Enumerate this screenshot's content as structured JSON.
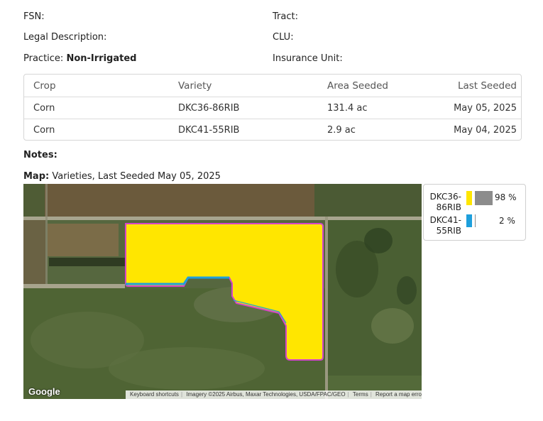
{
  "fields": {
    "fsn_label": "FSN:",
    "tract_label": "Tract:",
    "legal_label": "Legal Description:",
    "clu_label": "CLU:",
    "practice_label": "Practice:",
    "practice_value": "Non-Irrigated",
    "insurance_label": "Insurance Unit:"
  },
  "table": {
    "headers": [
      "Crop",
      "Variety",
      "Area Seeded",
      "Last Seeded"
    ],
    "rows": [
      [
        "Corn",
        "DKC36-86RIB",
        "131.4 ac",
        "May 05, 2025"
      ],
      [
        "Corn",
        "DKC41-55RIB",
        "2.9 ac",
        "May 04, 2025"
      ]
    ]
  },
  "notes_label": "Notes:",
  "map": {
    "label": "Map:",
    "caption": "Varieties, Last Seeded May 05, 2025",
    "google_logo": "Google",
    "attribution": {
      "shortcuts": "Keyboard shortcuts",
      "imagery": "Imagery ©2025 Airbus, Maxar Technologies, USDA/FPAC/GEO",
      "terms": "Terms",
      "report": "Report a map error"
    }
  },
  "legend": {
    "items": [
      {
        "name_line1": "DKC36-",
        "name_line2": "86RIB",
        "color": "#ffe600",
        "percent": 98,
        "percent_label": "98 %"
      },
      {
        "name_line1": "DKC41-",
        "name_line2": "55RIB",
        "color": "#1e9fdc",
        "percent": 2,
        "percent_label": "2 %"
      }
    ]
  }
}
